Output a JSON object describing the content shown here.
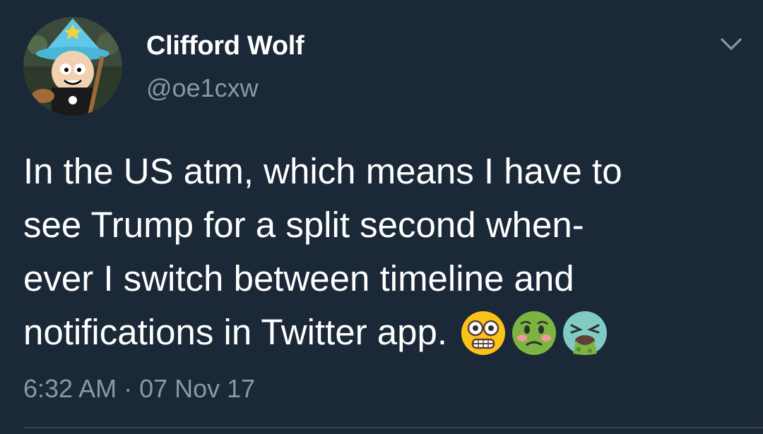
{
  "author": {
    "display_name": "Clifford Wolf",
    "handle": "@oe1cxw",
    "avatar_icon": "wizard-cartoon-avatar-icon"
  },
  "tweet": {
    "lines": [
      "In the US atm, which means I have to",
      "see Trump for a split second when-",
      "ever I switch between timeline and",
      "notifications in Twitter app."
    ],
    "emojis": [
      "flushed-face-icon",
      "nauseated-face-icon",
      "vomiting-face-icon"
    ]
  },
  "meta": {
    "timestamp": "6:32 AM · 07 Nov 17"
  },
  "colors": {
    "background": "#1b2837",
    "secondary_text": "#8899a6",
    "primary_text": "#ffffff"
  }
}
